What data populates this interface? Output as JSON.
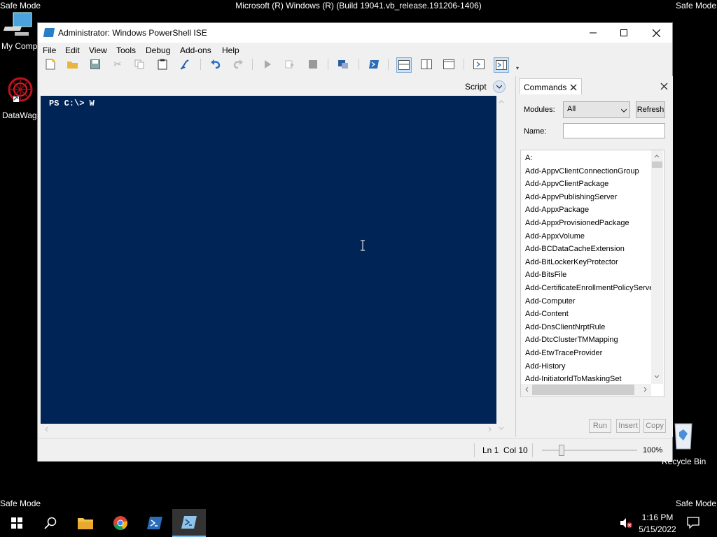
{
  "desktop": {
    "title": "Microsoft (R) Windows (R) (Build 19041.vb_release.191206-1406)",
    "safe_mode": "Safe Mode",
    "icons": {
      "my_computer": "My Comp",
      "datawagon": "DataWago",
      "recycle_bin": "Recycle Bin"
    }
  },
  "window": {
    "title": "Administrator: Windows PowerShell ISE",
    "menu": [
      "File",
      "Edit",
      "View",
      "Tools",
      "Debug",
      "Add-ons",
      "Help"
    ]
  },
  "script_pane": {
    "label": "Script",
    "console_text": "PS C:\\> W"
  },
  "commands": {
    "tab_label": "Commands",
    "modules_label": "Modules:",
    "modules_value": "All",
    "refresh_label": "Refresh",
    "name_label": "Name:",
    "name_value": "",
    "items": [
      "A:",
      "Add-AppvClientConnectionGroup",
      "Add-AppvClientPackage",
      "Add-AppvPublishingServer",
      "Add-AppxPackage",
      "Add-AppxProvisionedPackage",
      "Add-AppxVolume",
      "Add-BCDataCacheExtension",
      "Add-BitLockerKeyProtector",
      "Add-BitsFile",
      "Add-CertificateEnrollmentPolicyServe",
      "Add-Computer",
      "Add-Content",
      "Add-DnsClientNrptRule",
      "Add-DtcClusterTMMapping",
      "Add-EtwTraceProvider",
      "Add-History",
      "Add-InitiatorIdToMaskingSet"
    ],
    "run_label": "Run",
    "insert_label": "Insert",
    "copy_label": "Copy"
  },
  "status": {
    "position": "Ln 1  Col 10",
    "zoom": "100%"
  },
  "taskbar": {
    "time": "1:16 PM",
    "date": "5/15/2022"
  },
  "colors": {
    "console_bg": "#012456",
    "accent": "#0078d7"
  }
}
